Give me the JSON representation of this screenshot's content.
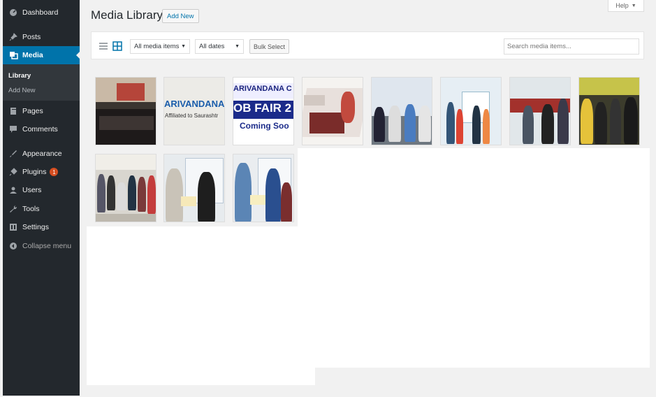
{
  "sidebar": {
    "items": [
      {
        "label": "Dashboard",
        "icon": "dashboard-icon"
      },
      {
        "label": "Posts",
        "icon": "pin-icon"
      },
      {
        "label": "Media",
        "icon": "media-icon"
      },
      {
        "label": "Pages",
        "icon": "page-icon"
      },
      {
        "label": "Comments",
        "icon": "comment-icon"
      },
      {
        "label": "Appearance",
        "icon": "brush-icon"
      },
      {
        "label": "Plugins",
        "icon": "plug-icon",
        "badge": "1"
      },
      {
        "label": "Users",
        "icon": "user-icon"
      },
      {
        "label": "Tools",
        "icon": "wrench-icon"
      },
      {
        "label": "Settings",
        "icon": "settings-icon"
      },
      {
        "label": "Collapse menu",
        "icon": "collapse-icon"
      }
    ],
    "submenu": [
      "Library",
      "Add New"
    ]
  },
  "header": {
    "title": "Media Library",
    "add_new": "Add New",
    "help": "Help"
  },
  "toolbar": {
    "filter_type": "All media items",
    "filter_date": "All dates",
    "bulk_select": "Bulk Select",
    "search_placeholder": "Search media items..."
  },
  "thumbnails": {
    "t2_text": [
      "ARIVANDANA",
      "Affiliated to Saurashtr"
    ],
    "t3_text": [
      "ARIVANDANA C",
      "OB FAIR 2",
      "Coming Soo"
    ]
  },
  "colors": {
    "accent": "#0073aa",
    "sidebar_bg": "#23282d",
    "badge": "#d54e21"
  }
}
